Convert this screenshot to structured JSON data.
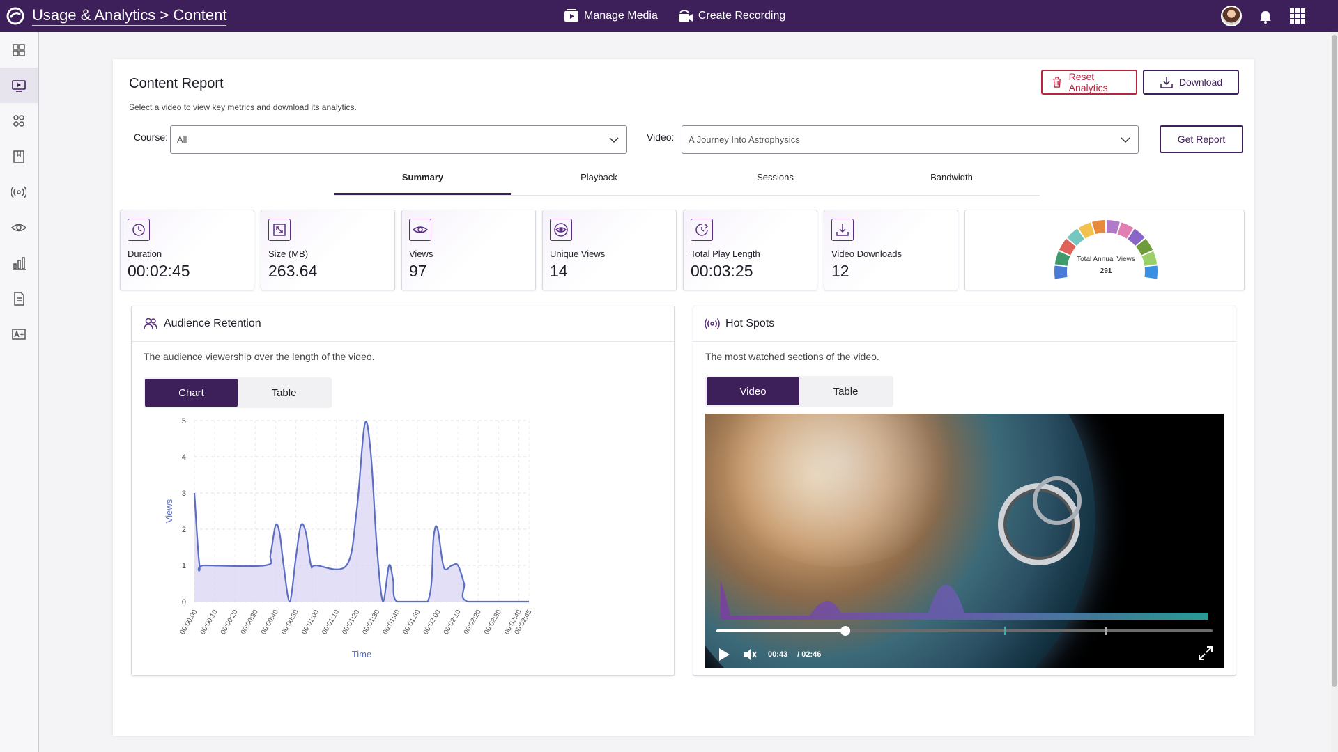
{
  "topbar": {
    "breadcrumb": "Usage & Analytics > Content",
    "manage_media": "Manage Media",
    "create_recording": "Create Recording"
  },
  "report": {
    "title": "Content Report",
    "subtitle": "Select a video to view key metrics and download its analytics.",
    "reset_label": "Reset Analytics",
    "download_label": "Download",
    "get_report_label": "Get Report",
    "course_label": "Course:",
    "course_value": "All",
    "video_label": "Video:",
    "video_value": "A Journey Into Astrophysics"
  },
  "tabs": [
    "Summary",
    "Playback",
    "Sessions",
    "Bandwidth"
  ],
  "metrics": [
    {
      "label": "Duration",
      "value": "00:02:45"
    },
    {
      "label": "Size (MB)",
      "value": "263.64"
    },
    {
      "label": "Views",
      "value": "97"
    },
    {
      "label": "Unique Views",
      "value": "14"
    },
    {
      "label": "Total Play Length",
      "value": "00:03:25"
    },
    {
      "label": "Video Downloads",
      "value": "12"
    }
  ],
  "gauge": {
    "label": "Total Annual Views",
    "value": "291",
    "colors": [
      "#4a7bd8",
      "#3f9b6b",
      "#e0635b",
      "#73c7c0",
      "#f2c14e",
      "#e88a3c",
      "#b07ac8",
      "#e27fb2",
      "#8a66c9",
      "#6d9b3a",
      "#9bcf6a",
      "#3a8fe0"
    ]
  },
  "retention": {
    "title": "Audience Retention",
    "description": "The audience viewership over the length of the video.",
    "seg_chart": "Chart",
    "seg_table": "Table"
  },
  "hotspots": {
    "title": "Hot Spots",
    "description": "The most watched sections of the video.",
    "seg_video": "Video",
    "seg_table": "Table",
    "current_time": "00:43",
    "total_time": "/ 02:46",
    "progress": 0.26
  },
  "chart_data": {
    "type": "area",
    "xlabel": "Time",
    "ylabel": "Views",
    "ylim": [
      0,
      5
    ],
    "yticks": [
      0,
      1,
      2,
      3,
      4,
      5
    ],
    "x": [
      "00:00:00",
      "00:00:10",
      "00:00:20",
      "00:00:30",
      "00:00:40",
      "00:00:50",
      "00:01:00",
      "00:01:10",
      "00:01:20",
      "00:01:30",
      "00:01:40",
      "00:01:50",
      "00:02:00",
      "00:02:10",
      "00:02:20",
      "00:02:30",
      "00:02:40",
      "00:02:45"
    ],
    "points": [
      [
        0,
        3
      ],
      [
        2.5,
        1
      ],
      [
        5,
        1
      ],
      [
        35,
        1
      ],
      [
        37.5,
        1.3
      ],
      [
        40,
        2.1
      ],
      [
        42,
        1.9
      ],
      [
        44,
        1
      ],
      [
        47,
        0
      ],
      [
        50,
        1.2
      ],
      [
        52.5,
        2.1
      ],
      [
        55,
        1.9
      ],
      [
        57.5,
        1
      ],
      [
        60,
        1
      ],
      [
        75,
        1
      ],
      [
        80,
        2.5
      ],
      [
        84,
        4.9
      ],
      [
        87,
        4.1
      ],
      [
        90,
        1.5
      ],
      [
        93,
        0
      ],
      [
        96,
        1
      ],
      [
        98,
        0.6
      ],
      [
        100,
        0
      ],
      [
        115,
        0
      ],
      [
        118,
        1.8
      ],
      [
        120,
        2
      ],
      [
        123,
        0.95
      ],
      [
        127,
        1
      ],
      [
        130,
        1
      ],
      [
        133,
        0.5
      ],
      [
        135,
        0
      ],
      [
        165,
        0
      ]
    ],
    "color": "#5b6fc2",
    "fill": "#d9d4f3",
    "grid": true
  }
}
